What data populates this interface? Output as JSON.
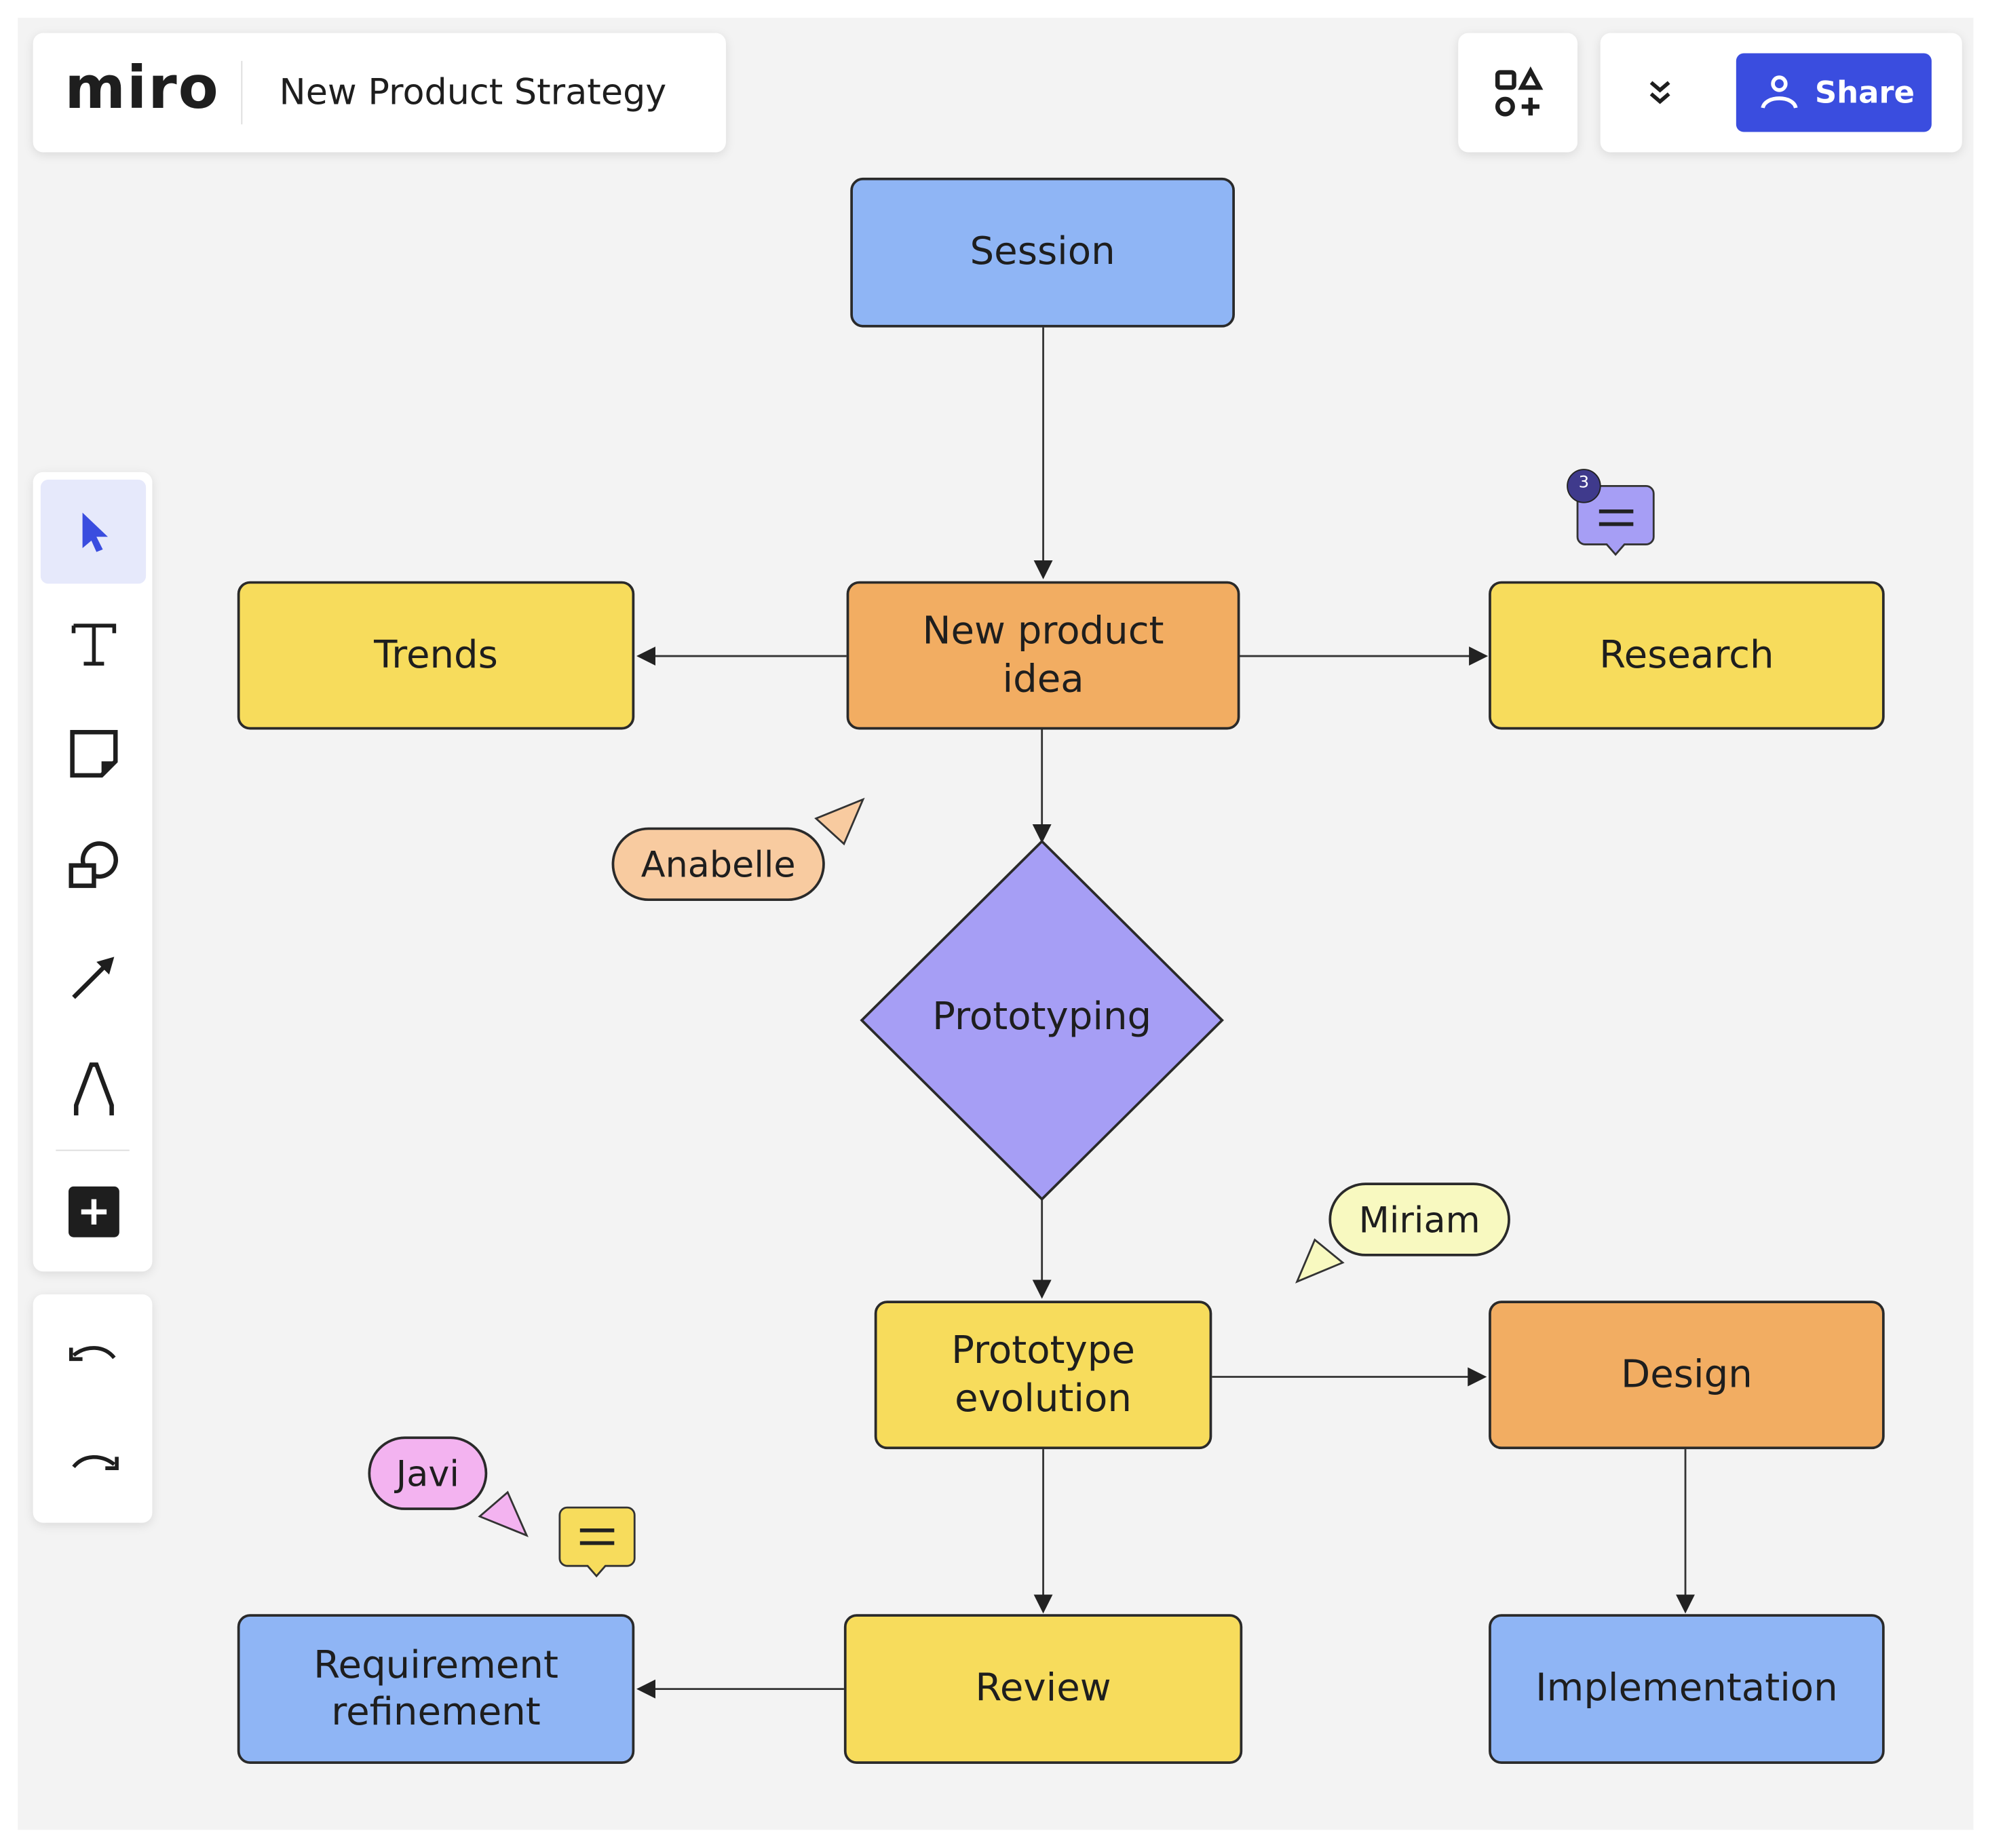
{
  "header": {
    "logo": "miro",
    "board_title": "New Product Strategy",
    "share_label": "Share"
  },
  "toolbar": {
    "tools": [
      "select",
      "text",
      "sticky-note",
      "shapes",
      "connection-line",
      "pen",
      "add-more"
    ],
    "history": [
      "undo",
      "redo"
    ]
  },
  "nodes": {
    "session": "Session",
    "new_product_idea": "New product idea",
    "trends": "Trends",
    "research": "Research",
    "prototyping": "Prototyping",
    "prototype_evolution": "Prototype evolution",
    "design": "Design",
    "review": "Review",
    "requirement_refinement": "Requirement refinement",
    "implementation": "Implementation"
  },
  "cursors": {
    "anabelle": "Anabelle",
    "miriam": "Miriam",
    "javi": "Javi"
  },
  "comments": {
    "research_count": "3"
  },
  "colors": {
    "accent": "#3a4ddf",
    "blue": "#8fb5f5",
    "orange": "#f2ad62",
    "yellow": "#f7dc5c",
    "purple": "#a69ef5"
  }
}
